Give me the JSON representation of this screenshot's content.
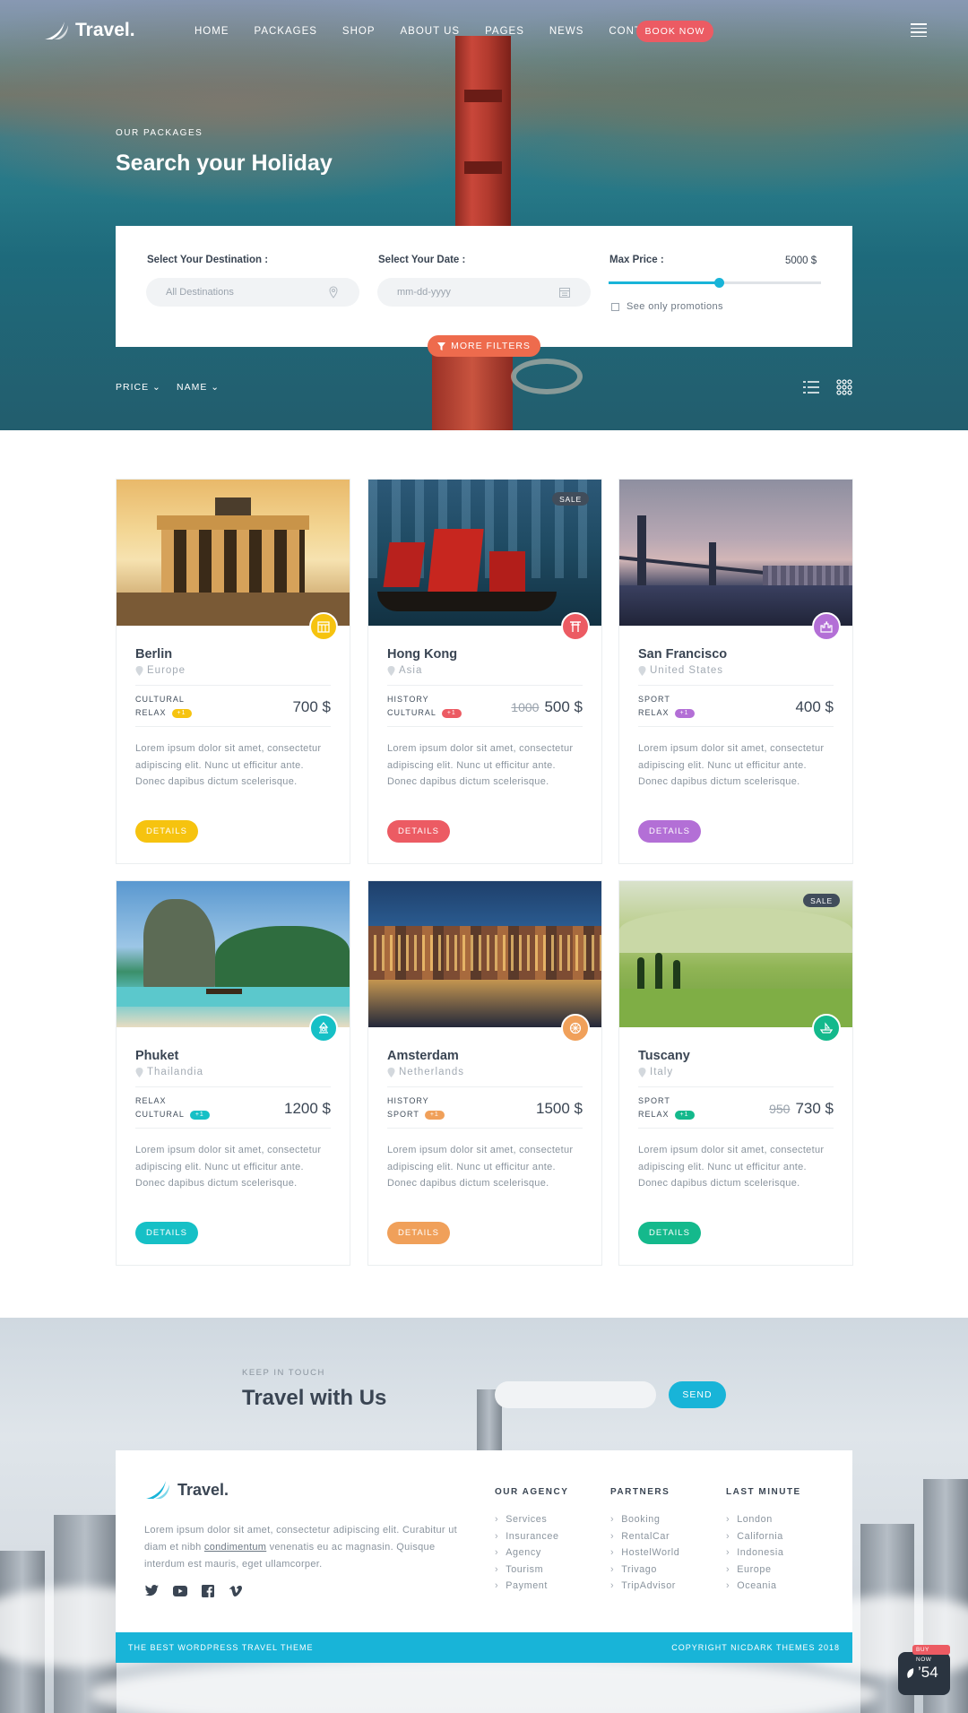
{
  "brand": {
    "name": "Travel",
    "dot": ".",
    "accent": "#18b4d8",
    "book_color": "#ec5b63"
  },
  "nav": {
    "items": [
      "HOME",
      "PACKAGES",
      "SHOP",
      "ABOUT US",
      "PAGES",
      "NEWS",
      "CONTACT"
    ],
    "book_label": "BOOK NOW"
  },
  "hero": {
    "kicker": "OUR PACKAGES",
    "title": "Search your Holiday"
  },
  "search": {
    "destination_label": "Select Your Destination :",
    "destination_placeholder": "All Destinations",
    "date_label": "Select Your Date :",
    "date_placeholder": "mm-dd-yyyy",
    "price_label": "Max Price :",
    "price_value": "5000 $",
    "price_slider_fraction": 0.52,
    "promotions_label": "See only promotions",
    "more_filters_label": "MORE FILTERS"
  },
  "sort": {
    "price_label": "PRICE",
    "name_label": "NAME"
  },
  "packages": [
    {
      "title": "Berlin",
      "location": "Europe",
      "tags": [
        "CULTURAL",
        "RELAX"
      ],
      "pill": "+1",
      "old_price": "",
      "price": "700 $",
      "color": "#f6c30f",
      "badge": "",
      "icon": "building-icon",
      "scene": "scene-berlin",
      "desc": "Lorem ipsum dolor sit amet, consectetur adipiscing elit. Nunc ut efficitur ante. Donec dapibus dictum scelerisque.",
      "details_label": "DETAILS"
    },
    {
      "title": "Hong Kong",
      "location": "Asia",
      "tags": [
        "HISTORY",
        "CULTURAL"
      ],
      "pill": "+1",
      "old_price": "1000",
      "price": "500 $",
      "color": "#ec5b63",
      "badge": "SALE",
      "icon": "torii-gate-icon",
      "scene": "scene-hk",
      "desc": "Lorem ipsum dolor sit amet, consectetur adipiscing elit. Nunc ut efficitur ante. Donec dapibus dictum scelerisque.",
      "details_label": "DETAILS"
    },
    {
      "title": "San Francisco",
      "location": "United States",
      "tags": [
        "SPORT",
        "RELAX"
      ],
      "pill": "+1",
      "old_price": "",
      "price": "400 $",
      "color": "#b36fd6",
      "badge": "",
      "icon": "castle-icon",
      "scene": "scene-sf",
      "desc": "Lorem ipsum dolor sit amet, consectetur adipiscing elit. Nunc ut efficitur ante. Donec dapibus dictum scelerisque.",
      "details_label": "DETAILS"
    },
    {
      "title": "Phuket",
      "location": "Thailandia",
      "tags": [
        "RELAX",
        "CULTURAL"
      ],
      "pill": "+1",
      "old_price": "",
      "price": "1200 $",
      "color": "#16c0c6",
      "badge": "",
      "icon": "temple-icon",
      "scene": "scene-phuket",
      "desc": "Lorem ipsum dolor sit amet, consectetur adipiscing elit. Nunc ut efficitur ante. Donec dapibus dictum scelerisque.",
      "details_label": "DETAILS"
    },
    {
      "title": "Amsterdam",
      "location": "Netherlands",
      "tags": [
        "HISTORY",
        "SPORT"
      ],
      "pill": "+1",
      "old_price": "",
      "price": "1500 $",
      "color": "#f0a05a",
      "badge": "",
      "icon": "wheel-icon",
      "scene": "scene-ams",
      "desc": "Lorem ipsum dolor sit amet, consectetur adipiscing elit. Nunc ut efficitur ante. Donec dapibus dictum scelerisque.",
      "details_label": "DETAILS"
    },
    {
      "title": "Tuscany",
      "location": "Italy",
      "tags": [
        "SPORT",
        "RELAX"
      ],
      "pill": "+1",
      "old_price": "950",
      "price": "730 $",
      "color": "#14b98c",
      "badge": "SALE",
      "icon": "ship-icon",
      "scene": "scene-tus",
      "desc": "Lorem ipsum dolor sit amet, consectetur adipiscing elit. Nunc ut efficitur ante. Donec dapibus dictum scelerisque.",
      "details_label": "DETAILS"
    }
  ],
  "newsletter": {
    "kicker": "KEEP IN TOUCH",
    "title": "Travel with Us",
    "send_label": "SEND"
  },
  "footer": {
    "about_before": "Lorem ipsum dolor sit amet, consectetur adipiscing elit. Curabitur ut diam et nibh ",
    "about_link": "condimentum",
    "about_after": " venenatis eu ac magnasin. Quisque interdum est mauris, eget ullamcorper.",
    "columns": [
      {
        "title": "OUR AGENCY",
        "items": [
          "Services",
          "Insurancee",
          "Agency",
          "Tourism",
          "Payment"
        ]
      },
      {
        "title": "PARTNERS",
        "items": [
          "Booking",
          "RentalCar",
          "HostelWorld",
          "Trivago",
          "TripAdvisor"
        ]
      },
      {
        "title": "LAST MINUTE",
        "items": [
          "London",
          "California",
          "Indonesia",
          "Europe",
          "Oceania"
        ]
      }
    ],
    "bar_left": "THE BEST WORDPRESS TRAVEL THEME",
    "bar_right": "COPYRIGHT NICDARK THEMES 2018",
    "buy_tag": "BUY NOW",
    "buy_number": "54"
  }
}
